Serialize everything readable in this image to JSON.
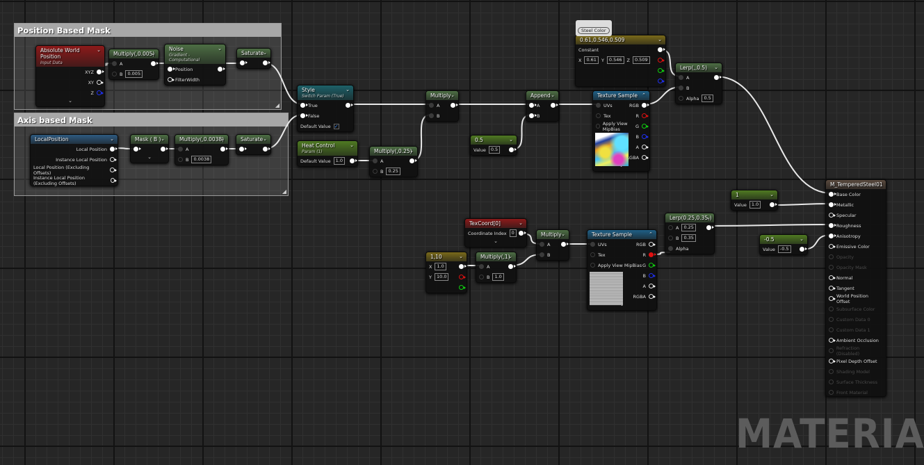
{
  "comments": {
    "position_mask": "Position Based Mask",
    "axis_mask": "Axis based Mask",
    "steel_color": "Steel Color"
  },
  "watermark": "MATERIAL",
  "nodes": {
    "awp": {
      "title": "Absolute World Position",
      "subtitle": "Input Data",
      "color": "#8c1a1a",
      "footer": "⌄",
      "rows": [
        {
          "out": "XYZ",
          "op": "filled"
        },
        {
          "out": "XY",
          "op": "hollow"
        },
        {
          "out": "Z",
          "op": "blue"
        }
      ]
    },
    "mul005": {
      "title": "Multiply(,0.005)",
      "color": "#4d6e44",
      "rows": [
        {
          "in": "A",
          "ip": "dim",
          "op": "filled"
        },
        {
          "in": "B",
          "ip": "hdim",
          "val": "0.005"
        }
      ]
    },
    "noise": {
      "title": "Noise",
      "subtitle": "Gradient - Computational",
      "color": "#4d6e44",
      "rows": [
        {
          "in": "Position",
          "ip": "filled",
          "op": "filled"
        },
        {
          "in": "FilterWidth",
          "ip": "hollow"
        }
      ]
    },
    "sat1": {
      "title": "Saturate",
      "color": "#4d6e44",
      "rows": [
        {
          "ip": "filled",
          "op": "filled"
        }
      ]
    },
    "localpos": {
      "title": "LocalPosition",
      "color": "#2e5a80",
      "rows": [
        {
          "out": "Local Position",
          "op": "filled"
        },
        {
          "out": "Instance Local Position",
          "op": "hollow"
        },
        {
          "out": "Local Position (Excluding Offsets)",
          "op": "hollow"
        },
        {
          "out": "Instance Local Position (Excluding Offsets)",
          "op": "hollow"
        }
      ]
    },
    "maskb": {
      "title": "Mask ( B )",
      "color": "#4d6e44",
      "footer": "⌄",
      "rows": [
        {
          "ip": "filled",
          "op": "filled"
        }
      ]
    },
    "mul0038": {
      "title": "Multiply(,0.0038)",
      "color": "#4d6e44",
      "rows": [
        {
          "in": "A",
          "ip": "dim",
          "op": "filled"
        },
        {
          "in": "B",
          "ip": "hdim",
          "val": "0.0038"
        }
      ]
    },
    "sat2": {
      "title": "Saturate",
      "color": "#4d6e44",
      "rows": [
        {
          "ip": "filled",
          "op": "filled"
        }
      ]
    },
    "style": {
      "title": "Style",
      "subtitle": "Switch Param (True)",
      "color": "#1d6068",
      "rows": [
        {
          "in": "True",
          "ip": "filled",
          "op": "filled"
        },
        {
          "in": "False",
          "ip": "filled"
        },
        {
          "in": "Default Value",
          "check": true
        }
      ]
    },
    "heat": {
      "title": "Heat Control",
      "subtitle": "Param (1)",
      "color": "#4f7a22",
      "rows": [
        {
          "in": "Default Value",
          "val": "1.0",
          "op": "filled"
        }
      ]
    },
    "mul025": {
      "title": "Multiply(,0.25)",
      "color": "#4d6e44",
      "rows": [
        {
          "in": "A",
          "ip": "dim",
          "op": "filled"
        },
        {
          "in": "B",
          "ip": "hdim",
          "val": "0.25"
        }
      ]
    },
    "multiply1": {
      "title": "Multiply",
      "color": "#4d6e44",
      "rows": [
        {
          "in": "A",
          "ip": "dim",
          "op": "filled"
        },
        {
          "in": "B",
          "ip": "dim"
        }
      ]
    },
    "half": {
      "title": "0.5",
      "color": "#4f7a22",
      "rows": [
        {
          "in": "Value",
          "val": "0.5",
          "op": "filled"
        }
      ]
    },
    "append": {
      "title": "Append",
      "color": "#4d6e44",
      "rows": [
        {
          "in": "A",
          "ip": "filled",
          "op": "filled"
        },
        {
          "in": "B",
          "ip": "filled"
        }
      ]
    },
    "const3": {
      "title": "0.61,0.546,0.509",
      "color": "#7a6a1a",
      "rows": [
        {
          "in": "Constant",
          "op": "filled"
        },
        {
          "fields": [
            {
              "l": "X",
              "v": "0.61"
            },
            {
              "l": "Y",
              "v": "0.546"
            },
            {
              "l": "Z",
              "v": "0.509"
            }
          ],
          "op": "red"
        },
        {
          "op": "green"
        },
        {
          "op": "blue"
        }
      ]
    },
    "tex1": {
      "title": "Texture Sample",
      "color": "#1f5f86",
      "footer": "⌄",
      "thumb": "iridescent",
      "rows": [
        {
          "in": "UVs",
          "ip": "dim",
          "out": "RGB",
          "op": "filled"
        },
        {
          "in": "Tex",
          "ip": "hdim",
          "out": "R",
          "op": "red"
        },
        {
          "in": "Apply View MipBias",
          "ip": "hdim",
          "out": "G",
          "op": "green"
        },
        {
          "out": "B",
          "op": "blue"
        },
        {
          "out": "A",
          "op": "hollow"
        },
        {
          "out": "RGBA",
          "op": "hollow"
        }
      ]
    },
    "lerp05": {
      "title": "Lerp(,,0.5)",
      "color": "#4d6e44",
      "rows": [
        {
          "in": "A",
          "ip": "dim",
          "op": "filled"
        },
        {
          "in": "B",
          "ip": "dim"
        },
        {
          "in": "Alpha",
          "ip": "hdim",
          "val": "0.5"
        }
      ]
    },
    "texcoord": {
      "title": "TexCoord[0]",
      "color": "#8c1a1a",
      "footer": "⌄",
      "rows": [
        {
          "in": "Coordinate Index",
          "val": "0",
          "op": "filled"
        }
      ]
    },
    "c110": {
      "title": "1,10",
      "color": "#7a6a1a",
      "rows": [
        {
          "in": "X",
          "val": "1.0",
          "op": "filled"
        },
        {
          "in": "Y",
          "val": "10.0",
          "op": "red"
        },
        {
          "op": "green"
        }
      ]
    },
    "mul1": {
      "title": "Multiply(,1)",
      "color": "#4d6e44",
      "rows": [
        {
          "in": "A",
          "ip": "dim",
          "op": "filled"
        },
        {
          "in": "B",
          "ip": "hdim",
          "val": "1.0"
        }
      ]
    },
    "multiply2": {
      "title": "Multiply",
      "color": "#4d6e44",
      "rows": [
        {
          "in": "A",
          "ip": "dim",
          "op": "filled"
        },
        {
          "in": "B",
          "ip": "dim"
        }
      ]
    },
    "tex2": {
      "title": "Texture Sample",
      "color": "#1f5f86",
      "footer": "⌄",
      "thumb": "brushed",
      "rows": [
        {
          "in": "UVs",
          "ip": "dim",
          "out": "RGB",
          "op": "hollow"
        },
        {
          "in": "Tex",
          "ip": "hdim",
          "out": "R",
          "op": "redf"
        },
        {
          "in": "Apply View MipBias",
          "ip": "hdim",
          "out": "G",
          "op": "green"
        },
        {
          "out": "B",
          "op": "blue"
        },
        {
          "out": "A",
          "op": "hollow"
        },
        {
          "out": "RGBA",
          "op": "hollow"
        }
      ]
    },
    "lerp2": {
      "title": "Lerp(0.25,0.35,)",
      "color": "#4d6e44",
      "rows": [
        {
          "in": "A",
          "ip": "hdim",
          "val": "0.25",
          "op": "filled"
        },
        {
          "in": "B",
          "ip": "hdim",
          "val": "0.35"
        },
        {
          "in": "Alpha",
          "ip": "dim"
        }
      ]
    },
    "one": {
      "title": "1",
      "color": "#4f7a22",
      "rows": [
        {
          "in": "Value",
          "val": "1.0",
          "op": "filled"
        }
      ]
    },
    "neg": {
      "title": "-0.5",
      "color": "#4f7a22",
      "rows": [
        {
          "in": "Value",
          "val": "-0.5",
          "op": "filled"
        }
      ]
    }
  },
  "result": {
    "title": "M_TemperedSteel01",
    "color": "#5a4a3e",
    "inputs": [
      {
        "label": "Base Color",
        "enabled": true,
        "connected": true
      },
      {
        "label": "Metallic",
        "enabled": true,
        "connected": true
      },
      {
        "label": "Specular",
        "enabled": true,
        "connected": false
      },
      {
        "label": "Roughness",
        "enabled": true,
        "connected": true
      },
      {
        "label": "Anisotropy",
        "enabled": true,
        "connected": true
      },
      {
        "label": "Emissive Color",
        "enabled": true,
        "connected": false
      },
      {
        "label": "Opacity",
        "enabled": false,
        "connected": false
      },
      {
        "label": "Opacity Mask",
        "enabled": false,
        "connected": false
      },
      {
        "label": "Normal",
        "enabled": true,
        "connected": false
      },
      {
        "label": "Tangent",
        "enabled": true,
        "connected": false
      },
      {
        "label": "World Position Offset",
        "enabled": true,
        "connected": false
      },
      {
        "label": "Subsurface Color",
        "enabled": false,
        "connected": false
      },
      {
        "label": "Custom Data 0",
        "enabled": false,
        "connected": false
      },
      {
        "label": "Custom Data 1",
        "enabled": false,
        "connected": false
      },
      {
        "label": "Ambient Occlusion",
        "enabled": true,
        "connected": false
      },
      {
        "label": "Refraction (Disabled)",
        "enabled": false,
        "connected": false
      },
      {
        "label": "Pixel Depth Offset",
        "enabled": true,
        "connected": false
      },
      {
        "label": "Shading Model",
        "enabled": false,
        "connected": false
      },
      {
        "label": "Surface Thickness",
        "enabled": false,
        "connected": false
      },
      {
        "label": "Front Material",
        "enabled": false,
        "connected": false
      }
    ]
  }
}
